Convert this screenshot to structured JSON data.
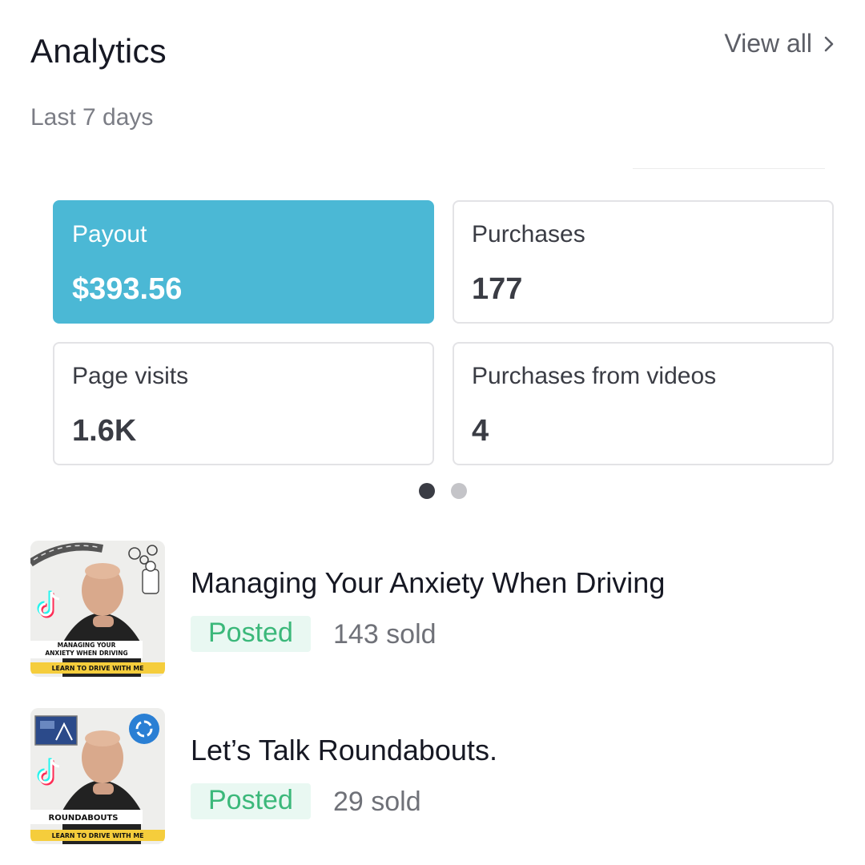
{
  "header": {
    "title": "Analytics",
    "view_all_label": "View all",
    "period": "Last 7 days"
  },
  "metrics": [
    {
      "label": "Payout",
      "value": "$393.56",
      "active": true
    },
    {
      "label": "Purchases",
      "value": "177",
      "active": false
    },
    {
      "label": "Page visits",
      "value": "1.6K",
      "active": false
    },
    {
      "label": "Purchases from videos",
      "value": "4",
      "active": false
    }
  ],
  "pager": {
    "count": 2,
    "current": 1
  },
  "products": [
    {
      "title": "Managing Your Anxiety When Driving",
      "status": "Posted",
      "sold": "143 sold",
      "thumb_caption_1": "MANAGING YOUR",
      "thumb_caption_2": "ANXIETY WHEN DRIVING",
      "thumb_banner": "LEARN TO DRIVE WITH ME",
      "thumb_icon": "road-icon"
    },
    {
      "title": "Let’s Talk Roundabouts.",
      "status": "Posted",
      "sold": "29 sold",
      "thumb_caption_1": "ROUNDABOUTS",
      "thumb_caption_2": "",
      "thumb_banner": "LEARN TO DRIVE WITH ME",
      "thumb_icon": "roundabout-icon"
    }
  ],
  "colors": {
    "accent": "#4bb8d5",
    "posted_text": "#3bb87a",
    "posted_bg": "#e9f8f2",
    "banner": "#f5cd3c"
  }
}
